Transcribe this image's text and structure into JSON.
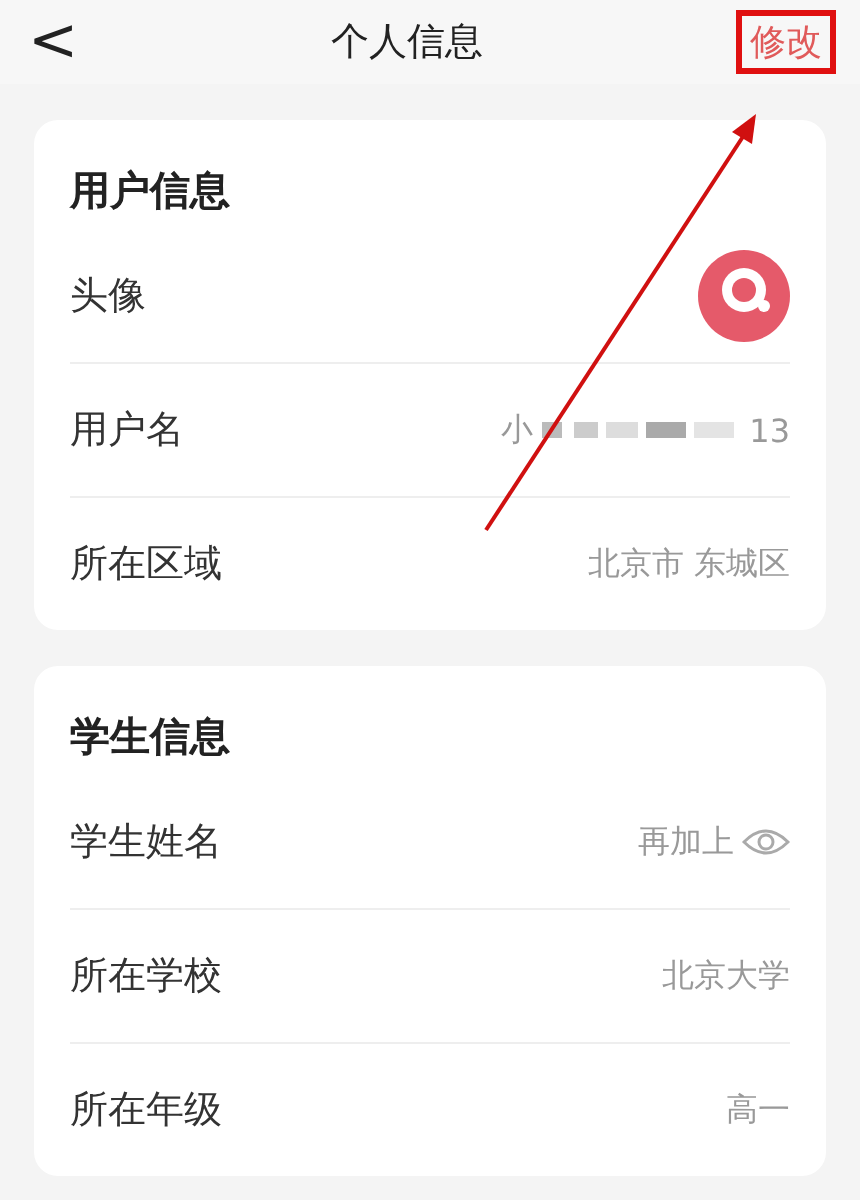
{
  "header": {
    "back": "<",
    "title": "个人信息",
    "action": "修改",
    "action_highlighted": true
  },
  "sections": [
    {
      "title": "用户信息",
      "rows": [
        {
          "kind": "avatar",
          "label": "头像"
        },
        {
          "kind": "redacted",
          "label": "用户名",
          "value": "小",
          "value_end": "13"
        },
        {
          "kind": "text",
          "label": "所在区域",
          "value": "北京市 东城区"
        }
      ]
    },
    {
      "title": "学生信息",
      "rows": [
        {
          "kind": "eye",
          "label": "学生姓名",
          "value": "再加上"
        },
        {
          "kind": "text",
          "label": "所在学校",
          "value": "北京大学"
        },
        {
          "kind": "text",
          "label": "所在年级",
          "value": "高一"
        }
      ]
    }
  ],
  "annotation": {
    "kind": "arrow"
  }
}
